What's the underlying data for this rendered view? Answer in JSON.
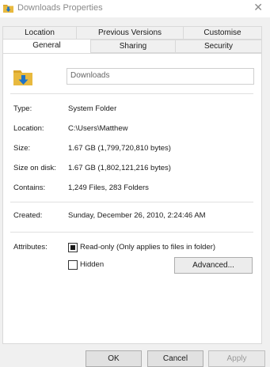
{
  "window": {
    "title": "Downloads Properties",
    "close_glyph": "✕"
  },
  "tabs": {
    "row1": [
      "Location",
      "Previous Versions",
      "Customise"
    ],
    "row2": [
      "General",
      "Sharing",
      "Security"
    ],
    "active": "General"
  },
  "general": {
    "folder_name": "Downloads",
    "type_label": "Type:",
    "type_value": "System Folder",
    "location_label": "Location:",
    "location_value": "C:\\Users\\Matthew",
    "size_label": "Size:",
    "size_value": "1.67 GB (1,799,720,810 bytes)",
    "size_on_disk_label": "Size on disk:",
    "size_on_disk_value": "1.67 GB (1,802,121,216 bytes)",
    "contains_label": "Contains:",
    "contains_value": "1,249 Files, 283 Folders",
    "created_label": "Created:",
    "created_value": "Sunday, December 26, 2010, 2:24:46 AM",
    "attributes_label": "Attributes:",
    "readonly_label": "Read-only (Only applies to files in folder)",
    "readonly_checked": true,
    "hidden_label": "Hidden",
    "hidden_checked": false,
    "advanced_label": "Advanced..."
  },
  "footer": {
    "ok_label": "OK",
    "cancel_label": "Cancel",
    "apply_label": "Apply"
  },
  "icons": {
    "title_icon": "folder-download-icon",
    "folder_icon": "folder-download-icon"
  },
  "colors": {
    "folder_yellow": "#e8b93e",
    "arrow_blue": "#1e73c8"
  }
}
